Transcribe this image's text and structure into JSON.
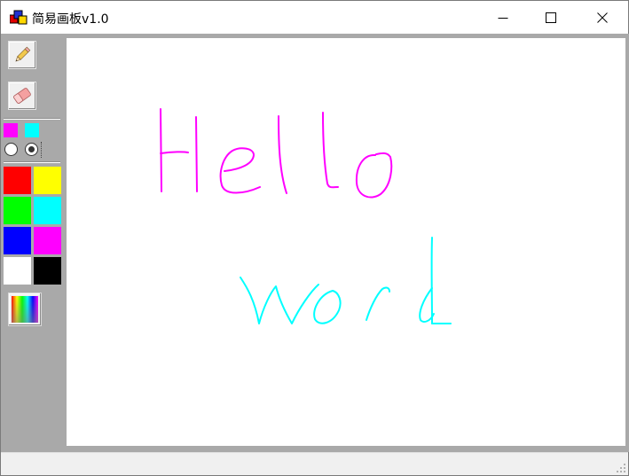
{
  "window": {
    "title": "简易画板v1.0",
    "controls": {
      "minimize": "minimize",
      "maximize": "maximize",
      "close": "close"
    }
  },
  "toolbox": {
    "tools": [
      {
        "name": "pencil",
        "icon": "pencil-icon"
      },
      {
        "name": "eraser",
        "icon": "eraser-icon"
      }
    ],
    "current_colors": {
      "foreground": "#ff00ff",
      "background": "#00ffff"
    },
    "brush_radio": {
      "selected": "right"
    },
    "palette": [
      "#ff0000",
      "#ffff00",
      "#00ff00",
      "#00ffff",
      "#0000ff",
      "#ff00ff",
      "#ffffff",
      "#000000"
    ],
    "custom_color_icon": "color-spectrum-icon"
  },
  "canvas": {
    "background": "#ffffff",
    "strokes": [
      {
        "text": "Hello",
        "color": "#ff00ff"
      },
      {
        "text": "word",
        "color": "#00ffff"
      }
    ]
  },
  "statusbar": {
    "text": ""
  }
}
